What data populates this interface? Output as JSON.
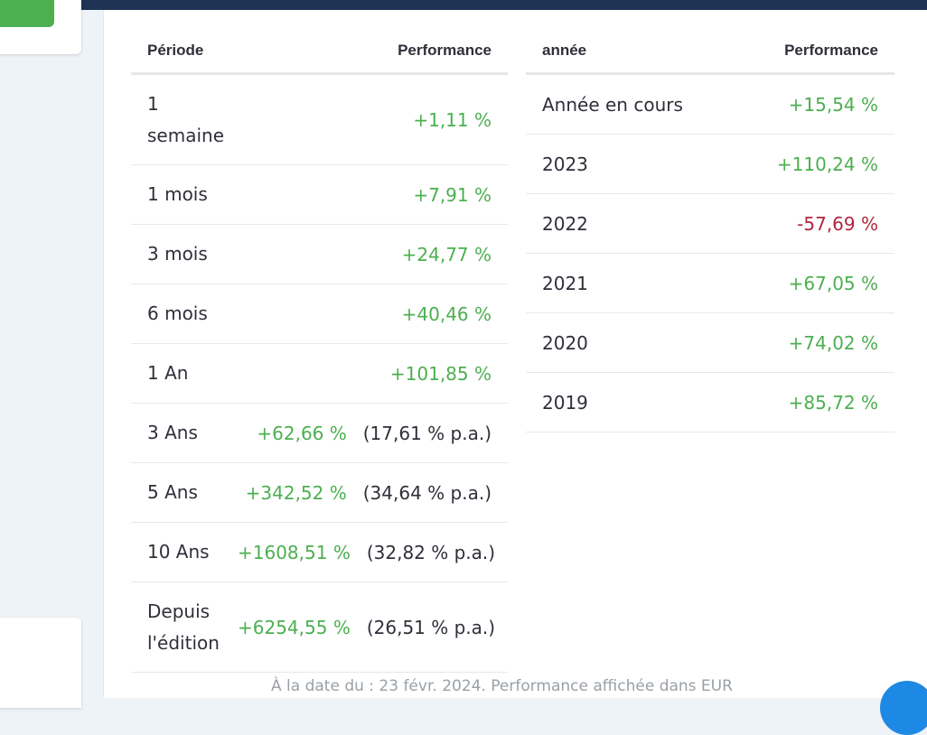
{
  "periods_table": {
    "header_period": "Période",
    "header_performance": "Performance",
    "rows": [
      {
        "label": "1 semaine",
        "value": "+1,11 %",
        "pa": ""
      },
      {
        "label": "1 mois",
        "value": "+7,91 %",
        "pa": ""
      },
      {
        "label": "3 mois",
        "value": "+24,77 %",
        "pa": ""
      },
      {
        "label": "6 mois",
        "value": "+40,46 %",
        "pa": ""
      },
      {
        "label": "1 An",
        "value": "+101,85 %",
        "pa": ""
      },
      {
        "label": "3 Ans",
        "value": "+62,66 %",
        "pa": "(17,61 % p.a.)"
      },
      {
        "label": "5 Ans",
        "value": "+342,52 %",
        "pa": "(34,64 % p.a.)"
      },
      {
        "label": "10 Ans",
        "value": "+1608,51 %",
        "pa": "(32,82 % p.a.)"
      },
      {
        "label": "Depuis l'édition",
        "value": "+6254,55 %",
        "pa": "(26,51 % p.a.)"
      }
    ]
  },
  "years_table": {
    "header_year": "année",
    "header_performance": "Performance",
    "rows": [
      {
        "label": "Année en cours",
        "value": "+15,54 %"
      },
      {
        "label": "2023",
        "value": "+110,24 %"
      },
      {
        "label": "2022",
        "value": "-57,69 %"
      },
      {
        "label": "2021",
        "value": "+67,05 %"
      },
      {
        "label": "2020",
        "value": "+74,02 %"
      },
      {
        "label": "2019",
        "value": "+85,72 %"
      }
    ]
  },
  "footnote": "À la date du : 23 févr. 2024. Performance affichée dans EUR",
  "colors": {
    "positive": "#4caf50",
    "negative": "#b0263d",
    "topbar": "#1e3253",
    "fab": "#1e88e5"
  }
}
